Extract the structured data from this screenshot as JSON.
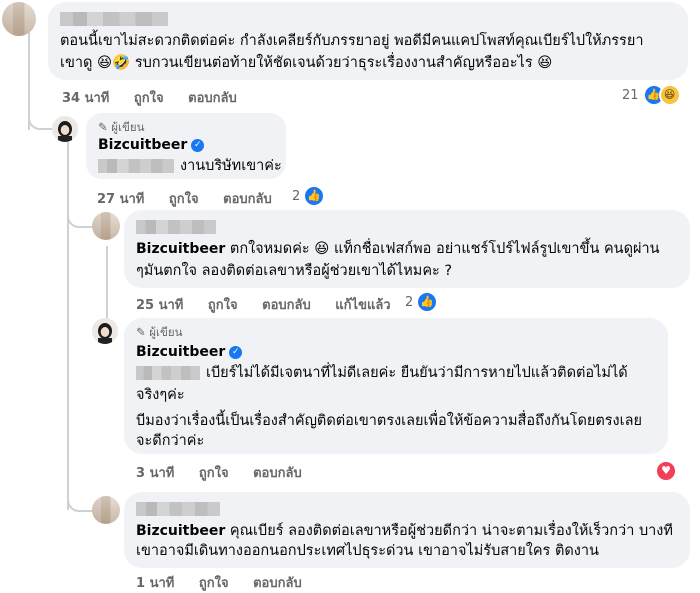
{
  "comment1": {
    "text_line1": "ตอนนี้เขาไม่สะดวกติดต่อค่ะ กำลังเคลียร์กับภรรยาอยู่ พอดีมีคนแคปโพสท์คุณเบียร์ไปให้ภรรยา",
    "text_line2": "เขาดู 😆🤣 รบกวนเขียนต่อท้ายให้ชัดเจนด้วยว่าธุระเรื่องงานสำคัญหรืออะไร 😆",
    "time": "34 นาที",
    "like_label": "ถูกใจ",
    "reply_label": "ตอบกลับ",
    "reaction_count": "21"
  },
  "comment2": {
    "badge": "ผู้เขียน",
    "author": "Bizcuitbeer",
    "text": "งานบริษัทเขาค่ะ",
    "time": "27 นาที",
    "like_label": "ถูกใจ",
    "reply_label": "ตอบกลับ",
    "reaction_count": "2"
  },
  "comment3": {
    "mention": "Bizcuitbeer",
    "text_line1": "ตกใจหมดค่ะ 😆 แท็กชื่อเฟสก์พอ อย่าแชร์โปร์ไฟล์รูปเขาขึ้น คนดูผ่าน",
    "text_line2": "ๆมันตกใจ ลองติดต่อเลขาหรือผู้ช่วยเขาได้ไหมคะ ?",
    "time": "25 นาที",
    "like_label": "ถูกใจ",
    "reply_label": "ตอบกลับ",
    "edited_label": "แก้ไขแล้ว",
    "reaction_count": "2"
  },
  "comment4": {
    "badge": "ผู้เขียน",
    "author": "Bizcuitbeer",
    "text_line1": "เบียร์ไม่ได้มีเจตนาที่ไม่ดีเลยค่ะ ยืนยันว่ามีการหายไปแล้วติดต่อไม่ได้",
    "text_line2": "จริงๆค่ะ",
    "text_line3": "บีมองว่าเรื่องนี้เป็นเรื่องสำคัญติดต่อเขาตรงเลยเพื่อให้ข้อความสื่อถึงกันโดยตรงเลย",
    "text_line4": "จะดีกว่าค่ะ",
    "time": "3 นาที",
    "like_label": "ถูกใจ",
    "reply_label": "ตอบกลับ"
  },
  "comment5": {
    "mention": "Bizcuitbeer",
    "text_line1": "คุณเบียร์ ลองติดต่อเลขาหรือผู้ช่วยดีกว่า น่าจะตามเรื่องให้เร็วกว่า บางที",
    "text_line2": "เขาอาจมีเดินทางออกนอกประเทศไปธุระด่วน เขาอาจไม่รับสายใคร ติดงาน",
    "time": "1 นาที",
    "like_label": "ถูกใจ",
    "reply_label": "ตอบกลับ"
  },
  "icons": {
    "like": "like-icon",
    "haha": "haha-icon",
    "heart": "heart-icon",
    "verified": "verified-badge-icon",
    "pencil": "pencil-icon"
  },
  "colors": {
    "bubble": "#f0f2f5",
    "meta_text": "#65676b",
    "like_blue": "#1877f2",
    "heart_red": "#f33e58"
  }
}
